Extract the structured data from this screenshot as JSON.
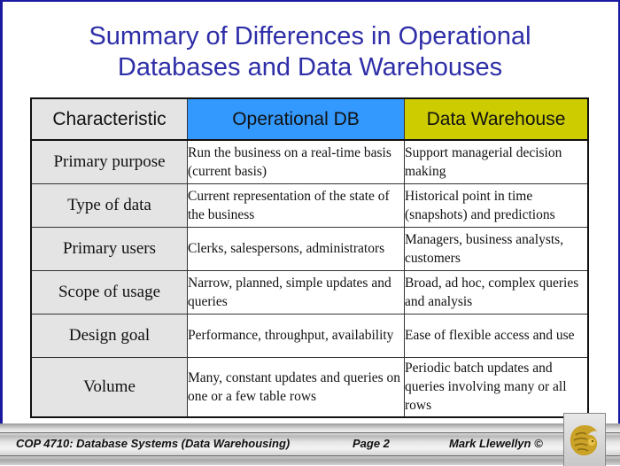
{
  "slide": {
    "title_line1": "Summary of Differences in Operational",
    "title_line2": "Databases and Data Warehouses"
  },
  "table": {
    "headers": [
      "Characteristic",
      "Operational DB",
      "Data Warehouse"
    ],
    "header_colors": [
      "#e4e4e4",
      "#3399ff",
      "#cccc00"
    ],
    "rows": [
      {
        "characteristic": "Primary purpose",
        "operational": "Run the business on a real-time basis (current basis)",
        "warehouse": "Support managerial decision making"
      },
      {
        "characteristic": "Type of data",
        "operational": "Current representation of the state of the business",
        "warehouse": "Historical point in time (snapshots) and  predictions"
      },
      {
        "characteristic": "Primary users",
        "operational": "Clerks, salespersons, administrators",
        "warehouse": "Managers, business analysts, customers"
      },
      {
        "characteristic": "Scope of usage",
        "operational": "Narrow, planned, simple updates and queries",
        "warehouse": "Broad, ad hoc, complex queries and analysis"
      },
      {
        "characteristic": "Design goal",
        "operational": "Performance, throughput, availability",
        "warehouse": "Ease of flexible access and use"
      },
      {
        "characteristic": "Volume",
        "operational": "Many, constant updates and queries on one or a few table rows",
        "warehouse": "Periodic batch updates and queries involving many or all rows"
      }
    ]
  },
  "footer": {
    "course": "COP 4710: Database Systems  (Data Warehousing)",
    "page": "Page 2",
    "author": "Mark Llewellyn ©",
    "logo_icon": "pegasus-logo-icon"
  }
}
